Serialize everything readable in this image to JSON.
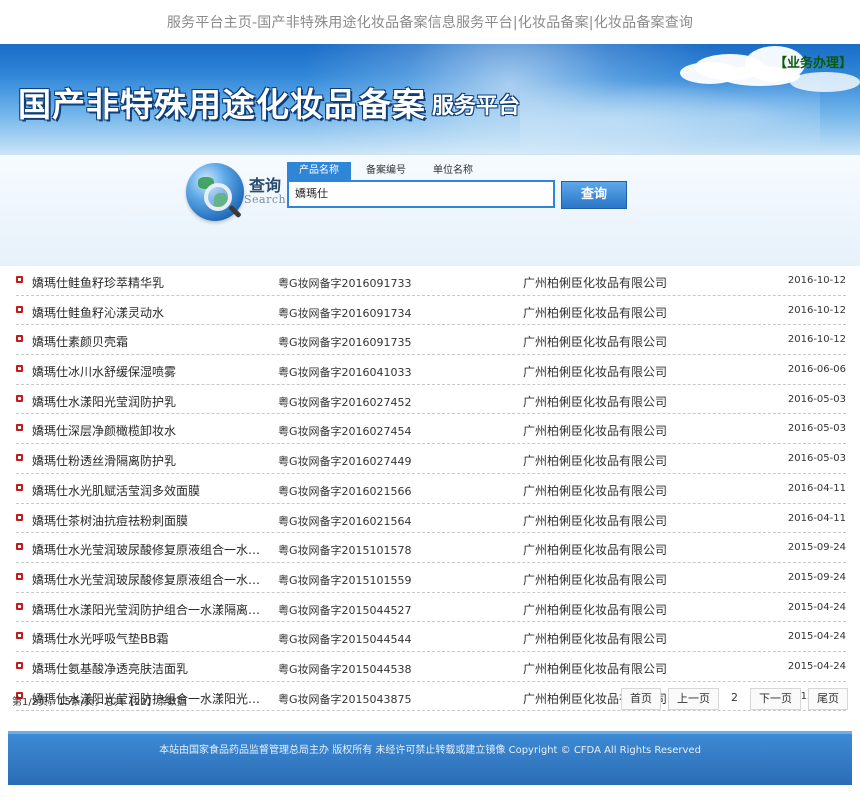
{
  "page": {
    "top_title": "服务平台主页-国产非特殊用途化妆品备案信息服务平台|化妆品备案|化妆品备案查询"
  },
  "banner": {
    "main_title": "国产非特殊用途化妆品备案",
    "sub_title": "服务平台",
    "business_link": "【业务办理】"
  },
  "search": {
    "label_cn": "查询",
    "label_en": "Search",
    "tabs": [
      {
        "label": "产品名称",
        "active": true
      },
      {
        "label": "备案编号",
        "active": false
      },
      {
        "label": "单位名称",
        "active": false
      }
    ],
    "input_value": "嬌瑪仕",
    "button_label": "查询"
  },
  "results": [
    {
      "name": "嬌瑪仕鲑鱼籽珍萃精华乳",
      "code": "粤G妆网备字2016091733",
      "company": "广州柏俐臣化妆品有限公司",
      "date": "2016-10-12"
    },
    {
      "name": "嬌瑪仕鲑鱼籽沁漾灵动水",
      "code": "粤G妆网备字2016091734",
      "company": "广州柏俐臣化妆品有限公司",
      "date": "2016-10-12"
    },
    {
      "name": "嬌瑪仕素颜贝壳霜",
      "code": "粤G妆网备字2016091735",
      "company": "广州柏俐臣化妆品有限公司",
      "date": "2016-10-12"
    },
    {
      "name": "嬌瑪仕冰川水舒缓保湿喷雾",
      "code": "粤G妆网备字2016041033",
      "company": "广州柏俐臣化妆品有限公司",
      "date": "2016-06-06"
    },
    {
      "name": "嬌瑪仕水漾阳光莹润防护乳",
      "code": "粤G妆网备字2016027452",
      "company": "广州柏俐臣化妆品有限公司",
      "date": "2016-05-03"
    },
    {
      "name": "嬌瑪仕深层净颜橄榄卸妆水",
      "code": "粤G妆网备字2016027454",
      "company": "广州柏俐臣化妆品有限公司",
      "date": "2016-05-03"
    },
    {
      "name": "嬌瑪仕粉透丝滑隔离防护乳",
      "code": "粤G妆网备字2016027449",
      "company": "广州柏俐臣化妆品有限公司",
      "date": "2016-05-03"
    },
    {
      "name": "嬌瑪仕水光肌赋活莹润多效面膜",
      "code": "粤G妆网备字2016021566",
      "company": "广州柏俐臣化妆品有限公司",
      "date": "2016-04-11"
    },
    {
      "name": "嬌瑪仕茶树油抗痘祛粉刺面膜",
      "code": "粤G妆网备字2016021564",
      "company": "广州柏俐臣化妆品有限公司",
      "date": "2016-04-11"
    },
    {
      "name": "嬌瑪仕水光莹润玻尿酸修复原液组合一水…",
      "code": "粤G妆网备字2015101578",
      "company": "广州柏俐臣化妆品有限公司",
      "date": "2015-09-24"
    },
    {
      "name": "嬌瑪仕水光莹润玻尿酸修复原液组合一水…",
      "code": "粤G妆网备字2015101559",
      "company": "广州柏俐臣化妆品有限公司",
      "date": "2015-09-24"
    },
    {
      "name": "嬌瑪仕水漾阳光莹润防护组合一水漾隔离…",
      "code": "粤G妆网备字2015044527",
      "company": "广州柏俐臣化妆品有限公司",
      "date": "2015-04-24"
    },
    {
      "name": "嬌瑪仕水光呼吸气垫BB霜",
      "code": "粤G妆网备字2015044544",
      "company": "广州柏俐臣化妆品有限公司",
      "date": "2015-04-24"
    },
    {
      "name": "嬌瑪仕氨基酸净透亮肤洁面乳",
      "code": "粤G妆网备字2015044538",
      "company": "广州柏俐臣化妆品有限公司",
      "date": "2015-04-24"
    },
    {
      "name": "嬌瑪仕水漾阳光莹润防护组合一水漾阳光…",
      "code": "粤G妆网备字2015043875",
      "company": "广州柏俐臣化妆品有限公司",
      "date": "2015-04-23"
    }
  ],
  "pager": {
    "info": "第1/2页，15条/页，总共【22】条数据",
    "first": "首页",
    "prev": "上一页",
    "current": "2",
    "next": "下一页",
    "last": "尾页"
  },
  "footer": {
    "text": "本站由国家食品药品监督管理总局主办 版权所有 未经许可禁止转载或建立镜像 Copyright © CFDA All Rights Reserved"
  },
  "colors": {
    "accent": "#2f86d8",
    "bullet": "#c41b1b",
    "footer": "#2a6db6"
  }
}
